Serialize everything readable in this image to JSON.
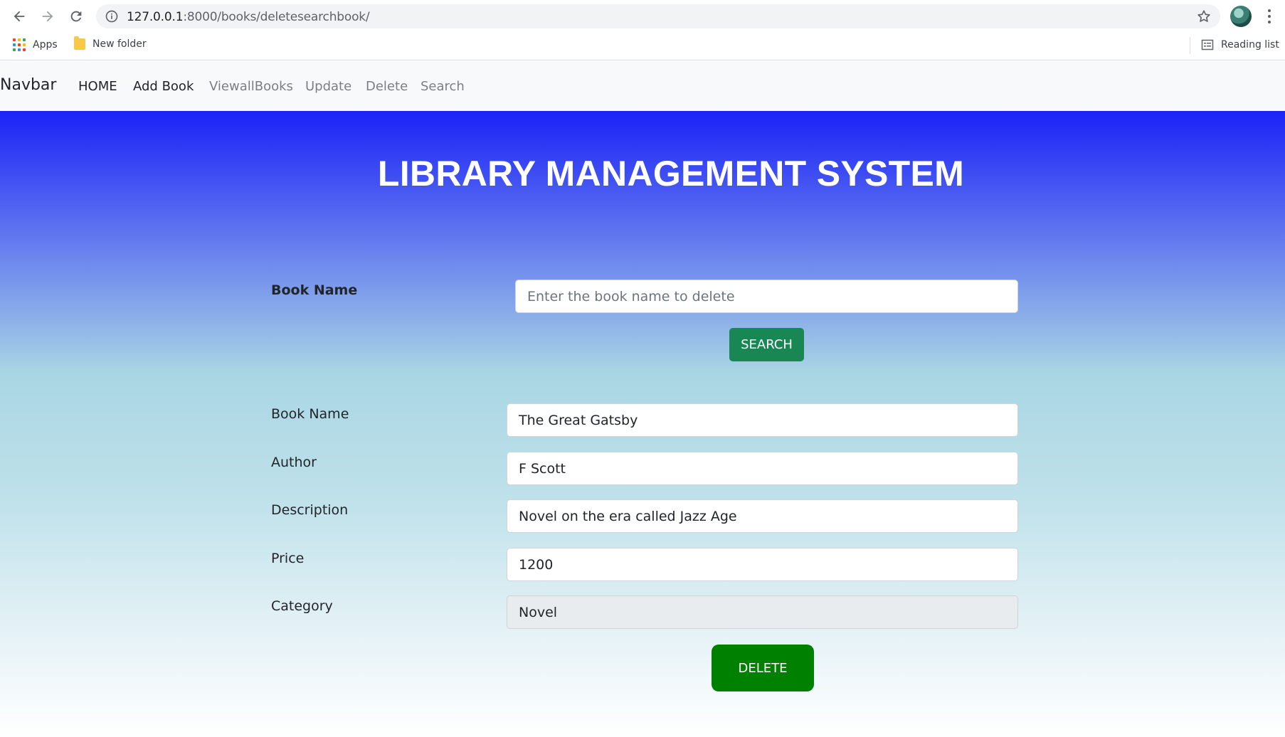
{
  "browser": {
    "url_host": "127.0.0.1",
    "url_path": ":8000/books/deletesearchbook/",
    "bookmarks": [
      {
        "label": "Apps",
        "icon": "apps-grid-icon"
      },
      {
        "label": "New folder",
        "icon": "folder-icon"
      }
    ],
    "reading_list_label": "Reading list"
  },
  "navbar": {
    "brand": "Navbar",
    "links": [
      {
        "label": "HOME"
      },
      {
        "label": "Add Book"
      },
      {
        "label": "ViewallBooks"
      },
      {
        "label": "Update"
      },
      {
        "label": "Delete"
      },
      {
        "label": "Search"
      }
    ]
  },
  "page": {
    "title": "LIBRARY MANAGEMENT SYSTEM",
    "search": {
      "label": "Book Name",
      "placeholder": "Enter the book name to delete",
      "button_label": "SEARCH"
    },
    "book": {
      "fields": [
        {
          "label": "Book Name",
          "value": "The Great Gatsby"
        },
        {
          "label": "Author",
          "value": "F Scott"
        },
        {
          "label": "Description",
          "value": "Novel on the era called Jazz Age"
        },
        {
          "label": "Price",
          "value": "1200"
        },
        {
          "label": "Category",
          "value": "Novel"
        }
      ],
      "delete_label": "DELETE"
    }
  },
  "colors": {
    "gradient_top": "#1a22f6",
    "search_button": "#198754",
    "delete_button": "#008000"
  }
}
